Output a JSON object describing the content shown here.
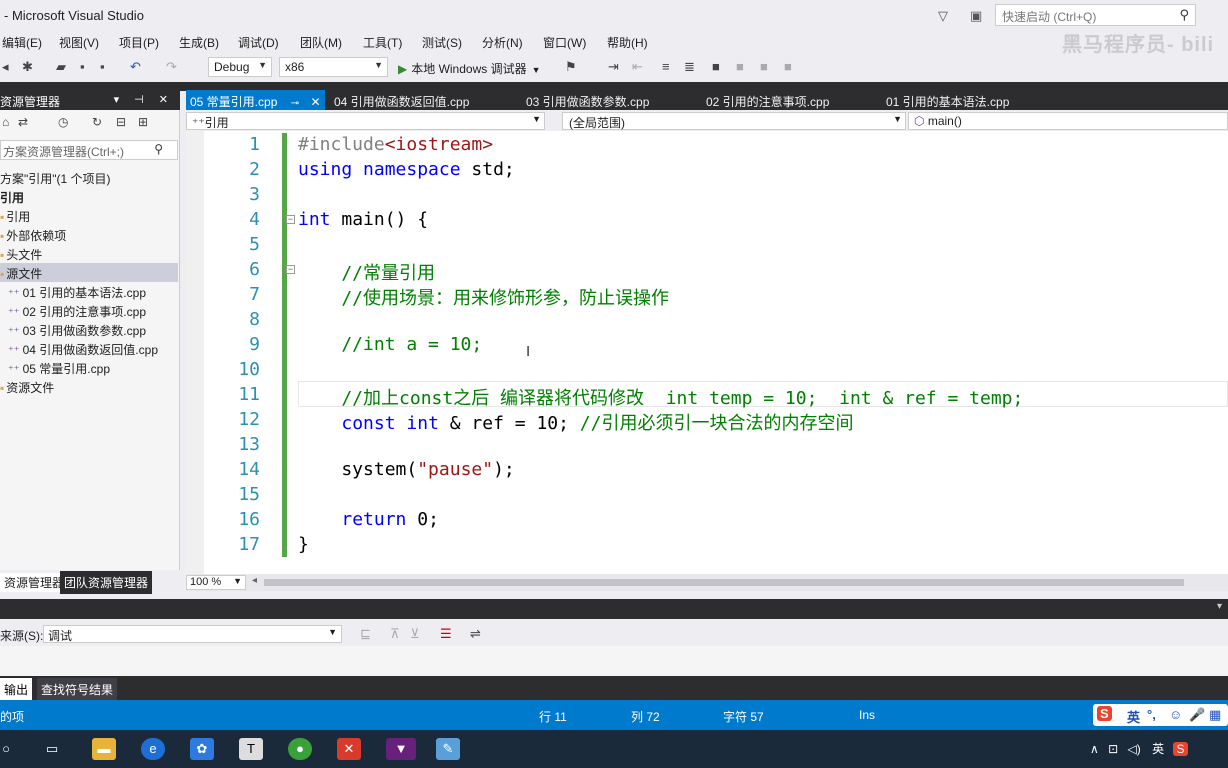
{
  "window": {
    "title": "- Microsoft Visual Studio",
    "quick_launch_placeholder": "快速启动 (Ctrl+Q)",
    "watermark": "黑马程序员- bili"
  },
  "menu": [
    "编辑(E)",
    "视图(V)",
    "项目(P)",
    "生成(B)",
    "调试(D)",
    "团队(M)",
    "工具(T)",
    "测试(S)",
    "分析(N)",
    "窗口(W)",
    "帮助(H)"
  ],
  "toolbar": {
    "config": "Debug",
    "platform": "x86",
    "run_label": "本地 Windows 调试器"
  },
  "solution_explorer": {
    "title": "资源管理器",
    "search_placeholder": "方案资源管理器(Ctrl+;)",
    "items": [
      {
        "label": "方案\"引用\"(1 个项目)",
        "kind": "solution"
      },
      {
        "label": "引用",
        "kind": "project"
      },
      {
        "label": "引用",
        "kind": "folder"
      },
      {
        "label": "外部依赖项",
        "kind": "folder"
      },
      {
        "label": "头文件",
        "kind": "folder"
      },
      {
        "label": "源文件",
        "kind": "folder"
      },
      {
        "label": "01 引用的基本语法.cpp",
        "kind": "file"
      },
      {
        "label": "02 引用的注意事项.cpp",
        "kind": "file"
      },
      {
        "label": "03 引用做函数参数.cpp",
        "kind": "file"
      },
      {
        "label": "04 引用做函数返回值.cpp",
        "kind": "file"
      },
      {
        "label": "05 常量引用.cpp",
        "kind": "file"
      },
      {
        "label": "资源文件",
        "kind": "folder"
      }
    ],
    "tab_active": "资源管理器",
    "tab_other": "团队资源管理器"
  },
  "doc_tabs": [
    {
      "label": "05 常量引用.cpp",
      "active": true
    },
    {
      "label": "04 引用做函数返回值.cpp",
      "active": false
    },
    {
      "label": "03 引用做函数参数.cpp",
      "active": false
    },
    {
      "label": "02 引用的注意事项.cpp",
      "active": false
    },
    {
      "label": "01 引用的基本语法.cpp",
      "active": false
    }
  ],
  "navbar": {
    "project": "引用",
    "scope": "(全局范围)",
    "member": "main()"
  },
  "code_lines": [
    [
      {
        "t": "#include",
        "c": "pp"
      },
      {
        "t": "<iostream>",
        "c": "inc"
      }
    ],
    [
      {
        "t": "using",
        "c": "kw"
      },
      {
        "t": " "
      },
      {
        "t": "namespace",
        "c": "kw"
      },
      {
        "t": " std;"
      }
    ],
    [],
    [
      {
        "t": "int",
        "c": "kw"
      },
      {
        "t": " main() {"
      }
    ],
    [],
    [
      {
        "t": "    //常量引用",
        "c": "cm"
      }
    ],
    [
      {
        "t": "    //使用场景：用来修饰形参，防止误操作",
        "c": "cm"
      }
    ],
    [],
    [
      {
        "t": "    //int a = 10;",
        "c": "cm"
      }
    ],
    [],
    [
      {
        "t": "    //加上const之后 编译器将代码修改  int temp = 10;  int & ref = temp;",
        "c": "cm"
      }
    ],
    [
      {
        "t": "    "
      },
      {
        "t": "const",
        "c": "kw"
      },
      {
        "t": " "
      },
      {
        "t": "int",
        "c": "kw"
      },
      {
        "t": " & ref = 10; "
      },
      {
        "t": "//引用必须引一块合法的内存空间",
        "c": "cm"
      }
    ],
    [],
    [
      {
        "t": "    system("
      },
      {
        "t": "\"pause\"",
        "c": "str"
      },
      {
        "t": ");"
      }
    ],
    [],
    [
      {
        "t": "    "
      },
      {
        "t": "return",
        "c": "kw"
      },
      {
        "t": " 0;"
      }
    ],
    [
      {
        "t": "}"
      }
    ]
  ],
  "zoom": "100 %",
  "output": {
    "source_label": "来源(S):",
    "source_value": "调试",
    "tab_output": "输出",
    "tab_find": "查找符号结果"
  },
  "status": {
    "left": "的项",
    "line": "行 11",
    "col": "列 72",
    "ch": "字符 57",
    "mode": "Ins",
    "ime": "英"
  },
  "tray": {
    "lang": "英"
  }
}
